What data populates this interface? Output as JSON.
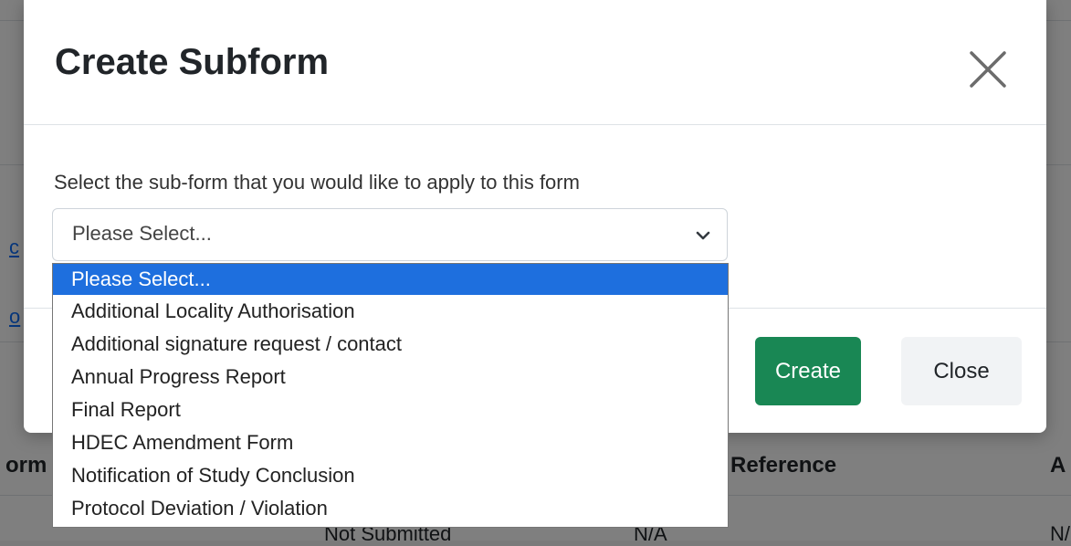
{
  "background": {
    "table_headers": [
      "orm",
      "Reference",
      "A"
    ],
    "cells": [
      "Not Submitted",
      "N/A",
      "N/"
    ],
    "links": [
      "c",
      "o"
    ]
  },
  "modal": {
    "title": "Create Subform",
    "body_label": "Select the sub-form that you would like to apply to this form",
    "select": {
      "value": "Please Select...",
      "options": [
        "Please Select...",
        "Additional Locality Authorisation",
        "Additional signature request / contact",
        "Annual Progress Report",
        "Final Report",
        "HDEC Amendment Form",
        "Notification of Study Conclusion",
        "Protocol Deviation / Violation"
      ],
      "highlighted_index": 0
    },
    "buttons": {
      "create": "Create",
      "close": "Close"
    }
  },
  "colors": {
    "create_button": "#198754",
    "highlight": "#1e6fde",
    "backdrop": "#7a7a7a"
  },
  "icons": {
    "close": "close-x-icon",
    "chevron": "chevron-down-icon"
  }
}
